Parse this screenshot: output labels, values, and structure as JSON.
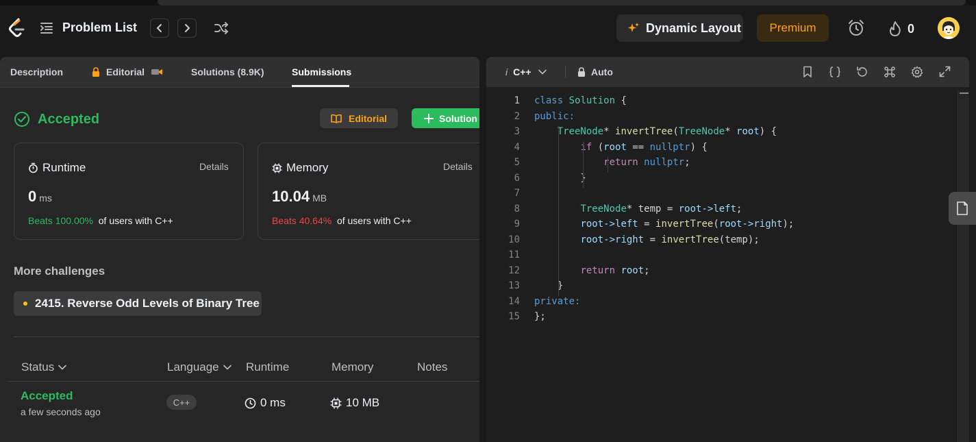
{
  "nav": {
    "problem_list": "Problem List",
    "dynamic_layout": "Dynamic Layout",
    "premium": "Premium",
    "streak_count": "0"
  },
  "tabs": [
    {
      "label": "Description",
      "active": false
    },
    {
      "label": "Editorial",
      "locked": true,
      "active": false
    },
    {
      "label": "Solutions (8.9K)",
      "active": false
    },
    {
      "label": "Submissions",
      "active": true
    }
  ],
  "result": {
    "status": "Accepted",
    "editorial_button": "Editorial",
    "solution_button": "Solution"
  },
  "runtime": {
    "title": "Runtime",
    "details": "Details",
    "value": "0",
    "unit": "ms",
    "beats": "Beats 100.00%",
    "suffix": "of users with C++",
    "beats_color": "#2cbb5d"
  },
  "memory": {
    "title": "Memory",
    "details": "Details",
    "value": "10.04",
    "unit": "MB",
    "beats": "Beats 40.64%",
    "suffix": "of users with C++",
    "beats_color": "#ef4743"
  },
  "challenges": {
    "title": "More challenges",
    "items": [
      "2415. Reverse Odd Levels of Binary Tree"
    ]
  },
  "table": {
    "headers": {
      "status": "Status",
      "language": "Language",
      "runtime": "Runtime",
      "memory": "Memory",
      "notes": "Notes"
    },
    "rows": [
      {
        "status": "Accepted",
        "time": "a few seconds ago",
        "language": "C++",
        "runtime": "0 ms",
        "memory": "10 MB",
        "notes": ""
      }
    ]
  },
  "editor": {
    "language_prefix": "i",
    "language": "C++",
    "mode": "Auto",
    "lines": [
      {
        "n": "1",
        "text": "class Solution {"
      },
      {
        "n": "2",
        "text": "public:"
      },
      {
        "n": "3",
        "text": "    TreeNode* invertTree(TreeNode* root) {"
      },
      {
        "n": "4",
        "text": "        if (root == nullptr) {"
      },
      {
        "n": "5",
        "text": "            return nullptr;"
      },
      {
        "n": "6",
        "text": "        }"
      },
      {
        "n": "7",
        "text": ""
      },
      {
        "n": "8",
        "text": "        TreeNode* temp = root->left;"
      },
      {
        "n": "9",
        "text": "        root->left = invertTree(root->right);"
      },
      {
        "n": "10",
        "text": "        root->right = invertTree(temp);"
      },
      {
        "n": "11",
        "text": ""
      },
      {
        "n": "12",
        "text": "        return root;"
      },
      {
        "n": "13",
        "text": "    }"
      },
      {
        "n": "14",
        "text": "private:"
      },
      {
        "n": "15",
        "text": "};"
      }
    ]
  },
  "colors": {
    "accent": "#ffa116",
    "success": "#2cbb5d",
    "danger": "#ef4743"
  }
}
